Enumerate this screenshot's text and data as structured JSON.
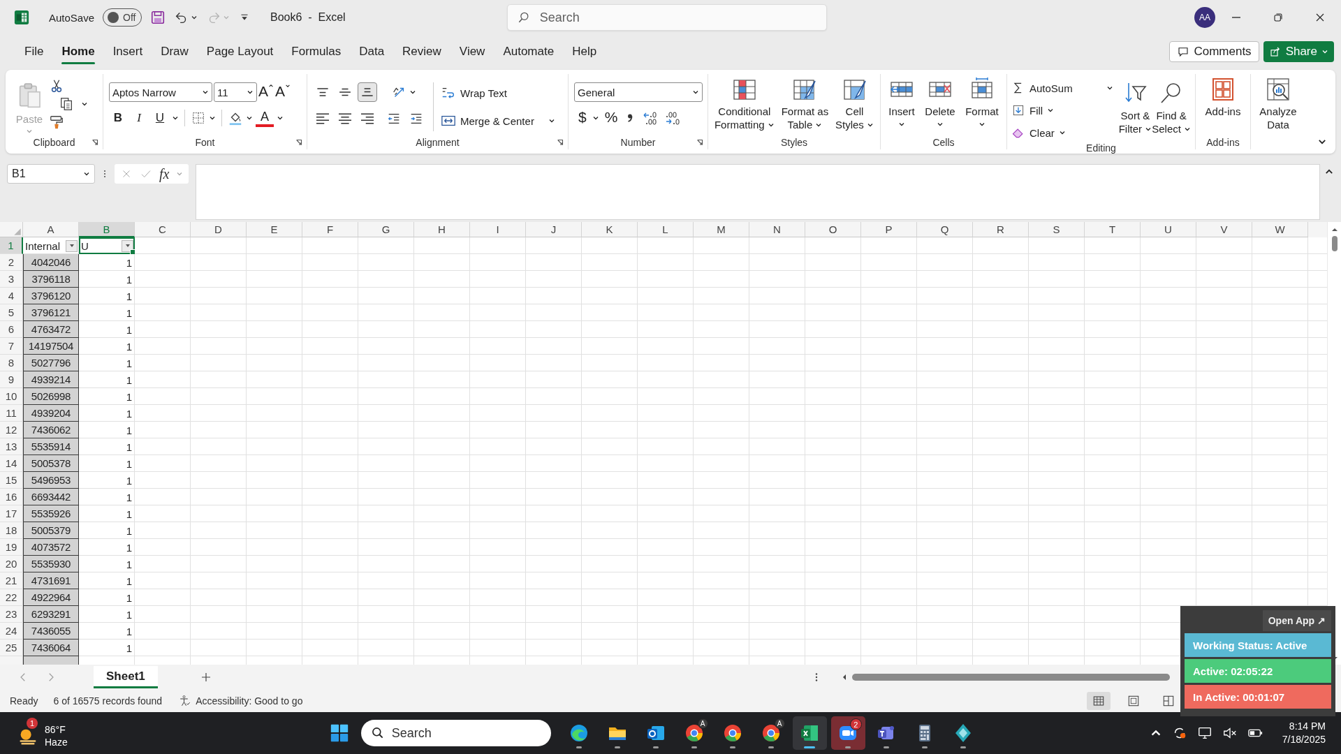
{
  "title_bar": {
    "autosave_label": "AutoSave",
    "autosave": {
      "on": false,
      "text": "Off"
    },
    "redo_disabled": true,
    "document_title": "Book6  -  Excel",
    "search": {
      "placeholder": "Search"
    },
    "account_initials": "AA"
  },
  "menu_tabs": [
    {
      "label": "File",
      "selected": false
    },
    {
      "label": "Home",
      "selected": true
    },
    {
      "label": "Insert",
      "selected": false
    },
    {
      "label": "Draw",
      "selected": false
    },
    {
      "label": "Page Layout",
      "selected": false
    },
    {
      "label": "Formulas",
      "selected": false
    },
    {
      "label": "Data",
      "selected": false
    },
    {
      "label": "Review",
      "selected": false
    },
    {
      "label": "View",
      "selected": false
    },
    {
      "label": "Automate",
      "selected": false
    },
    {
      "label": "Help",
      "selected": false
    }
  ],
  "comments_button": "Comments",
  "share_button": "Share",
  "ribbon": {
    "groups": [
      {
        "kind": "clipboard",
        "name": "Clipboard",
        "launcher": true,
        "paste": {
          "label": "Paste",
          "disabled": true
        }
      },
      {
        "kind": "font",
        "name": "Font",
        "launcher": true,
        "font_name": "Aptos Narrow",
        "font_size": "11",
        "grow_font": "A",
        "shrink_font": "A",
        "style_buttons": [
          "B",
          "I",
          "U"
        ],
        "font_color": "A"
      },
      {
        "kind": "alignment",
        "name": "Alignment",
        "launcher": true,
        "vertical_align": [
          {
            "selected": false
          },
          {
            "selected": false
          },
          {
            "selected": true
          }
        ],
        "horizontal_align": [
          {
            "selected": false
          },
          {
            "selected": false
          },
          {
            "selected": false
          }
        ],
        "wrap_text": "Wrap Text",
        "merge": "Merge & Center"
      },
      {
        "kind": "number",
        "name": "Number",
        "launcher": true,
        "format": "General",
        "currency": "$",
        "percent": "%"
      },
      {
        "kind": "styles",
        "name": "Styles",
        "buttons": [
          {
            "lines": [
              "Conditional",
              "Formatting"
            ]
          },
          {
            "lines": [
              "Format as",
              "Table"
            ]
          },
          {
            "lines": [
              "Cell",
              "Styles"
            ]
          }
        ]
      },
      {
        "kind": "cells",
        "name": "Cells",
        "buttons": [
          {
            "lines": [
              "Insert"
            ]
          },
          {
            "lines": [
              "Delete"
            ]
          },
          {
            "lines": [
              "Format"
            ]
          }
        ]
      },
      {
        "kind": "editing",
        "name": "Editing",
        "small_buttons": [
          "AutoSum",
          "Fill",
          "Clear"
        ],
        "buttons": [
          {
            "lines": [
              "Sort &",
              "Filter"
            ]
          },
          {
            "lines": [
              "Find &",
              "Select"
            ]
          }
        ]
      },
      {
        "kind": "addins",
        "name": "Add-ins",
        "buttons": [
          {
            "lines": [
              "Add-ins"
            ]
          }
        ]
      },
      {
        "kind": "analyze",
        "buttons": [
          {
            "lines": [
              "Analyze",
              "Data"
            ]
          }
        ]
      }
    ]
  },
  "formula_bar": {
    "name_box": "B1",
    "function_button": "fx"
  },
  "sheet": {
    "columns": [
      {
        "label": "A",
        "selected": false,
        "shaded": true,
        "centered": true
      },
      {
        "label": "B",
        "selected": true,
        "shaded": false,
        "centered": false
      },
      {
        "label": "C",
        "selected": false,
        "shaded": false
      },
      {
        "label": "D",
        "selected": false,
        "shaded": false
      },
      {
        "label": "E",
        "selected": false,
        "shaded": false
      },
      {
        "label": "F",
        "selected": false,
        "shaded": false
      },
      {
        "label": "G",
        "selected": false,
        "shaded": false
      },
      {
        "label": "H",
        "selected": false,
        "shaded": false
      },
      {
        "label": "I",
        "selected": false,
        "shaded": false
      },
      {
        "label": "J",
        "selected": false,
        "shaded": false
      },
      {
        "label": "K",
        "selected": false,
        "shaded": false
      },
      {
        "label": "L",
        "selected": false,
        "shaded": false
      },
      {
        "label": "M",
        "selected": false,
        "shaded": false
      },
      {
        "label": "N",
        "selected": false,
        "shaded": false
      },
      {
        "label": "O",
        "selected": false,
        "shaded": false
      },
      {
        "label": "P",
        "selected": false,
        "shaded": false
      },
      {
        "label": "Q",
        "selected": false,
        "shaded": false
      },
      {
        "label": "R",
        "selected": false,
        "shaded": false
      },
      {
        "label": "S",
        "selected": false,
        "shaded": false
      },
      {
        "label": "T",
        "selected": false,
        "shaded": false
      },
      {
        "label": "U",
        "selected": false,
        "shaded": false
      },
      {
        "label": "V",
        "selected": false,
        "shaded": false
      },
      {
        "label": "W",
        "selected": false,
        "shaded": false
      }
    ],
    "header_row": {
      "number": "1",
      "selected": true,
      "cells": [
        {
          "text": "Internal",
          "filter": true,
          "active": false
        },
        {
          "text": "U",
          "filter": true,
          "active": true
        }
      ]
    },
    "rows": [
      {
        "number": "2",
        "selected": false,
        "cells": [
          "4042046",
          "1"
        ]
      },
      {
        "number": "3",
        "selected": false,
        "cells": [
          "3796118",
          "1"
        ]
      },
      {
        "number": "4",
        "selected": false,
        "cells": [
          "3796120",
          "1"
        ]
      },
      {
        "number": "5",
        "selected": false,
        "cells": [
          "3796121",
          "1"
        ]
      },
      {
        "number": "6",
        "selected": false,
        "cells": [
          "4763472",
          "1"
        ]
      },
      {
        "number": "7",
        "selected": false,
        "cells": [
          "14197504",
          "1"
        ]
      },
      {
        "number": "8",
        "selected": false,
        "cells": [
          "5027796",
          "1"
        ]
      },
      {
        "number": "9",
        "selected": false,
        "cells": [
          "4939214",
          "1"
        ]
      },
      {
        "number": "10",
        "selected": false,
        "cells": [
          "5026998",
          "1"
        ]
      },
      {
        "number": "11",
        "selected": false,
        "cells": [
          "4939204",
          "1"
        ]
      },
      {
        "number": "12",
        "selected": false,
        "cells": [
          "7436062",
          "1"
        ]
      },
      {
        "number": "13",
        "selected": false,
        "cells": [
          "5535914",
          "1"
        ]
      },
      {
        "number": "14",
        "selected": false,
        "cells": [
          "5005378",
          "1"
        ]
      },
      {
        "number": "15",
        "selected": false,
        "cells": [
          "5496953",
          "1"
        ]
      },
      {
        "number": "16",
        "selected": false,
        "cells": [
          "6693442",
          "1"
        ]
      },
      {
        "number": "17",
        "selected": false,
        "cells": [
          "5535926",
          "1"
        ]
      },
      {
        "number": "18",
        "selected": false,
        "cells": [
          "5005379",
          "1"
        ]
      },
      {
        "number": "19",
        "selected": false,
        "cells": [
          "4073572",
          "1"
        ]
      },
      {
        "number": "20",
        "selected": false,
        "cells": [
          "5535930",
          "1"
        ]
      },
      {
        "number": "21",
        "selected": false,
        "cells": [
          "4731691",
          "1"
        ]
      },
      {
        "number": "22",
        "selected": false,
        "cells": [
          "4922964",
          "1"
        ]
      },
      {
        "number": "23",
        "selected": false,
        "cells": [
          "6293291",
          "1"
        ]
      },
      {
        "number": "24",
        "selected": false,
        "cells": [
          "7436055",
          "1"
        ]
      },
      {
        "number": "25",
        "selected": false,
        "cells": [
          "7436064",
          "1"
        ]
      }
    ]
  },
  "sheet_tabs": [
    {
      "label": "Sheet1",
      "selected": true
    }
  ],
  "status_bar": {
    "mode": "Ready",
    "filter_info": "6 of 16575 records found",
    "accessibility": "Accessibility: Good to go",
    "views": [
      {
        "selected": true
      },
      {
        "selected": false
      },
      {
        "selected": false
      }
    ]
  },
  "tracker_widget": {
    "open_app": "Open App ↗",
    "items": [
      {
        "text": "Working Status: Active",
        "color": "#5ab9d3"
      },
      {
        "text": "Active: 02:05:22",
        "color": "#4ccb7c"
      },
      {
        "text": "In Active: 00:01:07",
        "color": "#ef6a5e"
      }
    ]
  },
  "taskbar": {
    "weather": {
      "badge": "1",
      "temperature": "86°F",
      "condition": "Haze"
    },
    "search": {
      "placeholder": "Search"
    },
    "apps": [
      {
        "kind": "edge",
        "active": false,
        "flashing": false
      },
      {
        "kind": "folder",
        "active": false,
        "flashing": false
      },
      {
        "kind": "outlook",
        "active": false,
        "flashing": false
      },
      {
        "kind": "chrome",
        "active": false,
        "flashing": false,
        "badge": "A"
      },
      {
        "kind": "chrome",
        "active": false,
        "flashing": false
      },
      {
        "kind": "chrome",
        "active": false,
        "flashing": false,
        "badge": "A"
      },
      {
        "kind": "excel",
        "active": true,
        "flashing": false
      },
      {
        "kind": "zoom",
        "active": false,
        "flashing": true,
        "badge": "2"
      },
      {
        "kind": "teams",
        "active": false,
        "flashing": false
      },
      {
        "kind": "calculator",
        "active": false,
        "flashing": false
      },
      {
        "kind": "diamond",
        "active": false,
        "flashing": false
      }
    ],
    "clock": {
      "time": "8:14 PM",
      "date": "7/18/2025"
    }
  }
}
